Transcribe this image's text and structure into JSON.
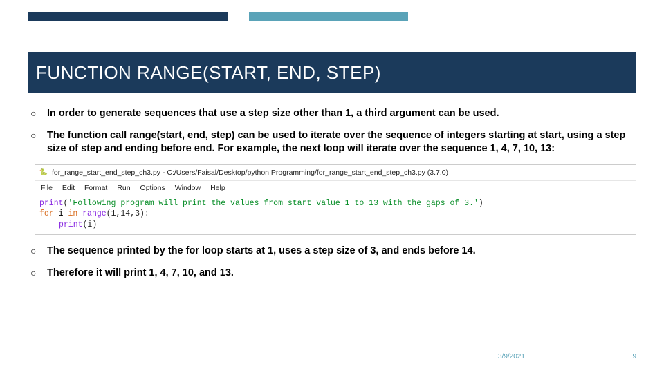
{
  "title": "FUNCTION RANGE(START, END, STEP)",
  "bullets": {
    "b1": "In order to generate sequences that use a step size other than 1, a third argument can be used.",
    "b2": "The function call range(start, end, step) can be used to iterate over the sequence of integers starting at start, using a step size of step and ending before end. For example, the next loop will iterate over the sequence 1, 4, 7, 10, 13:",
    "b3": "The sequence printed by the for loop starts at 1, uses a step size of 3, and ends before 14.",
    "b4": "Therefore it will print 1, 4, 7, 10, and 13."
  },
  "idle": {
    "icon": "🐍",
    "window_title": "for_range_start_end_step_ch3.py - C:/Users/Faisal/Desktop/python Programming/for_range_start_end_step_ch3.py (3.7.0)",
    "menus": {
      "file": "File",
      "edit": "Edit",
      "format": "Format",
      "run": "Run",
      "options": "Options",
      "window": "Window",
      "help": "Help"
    },
    "code": {
      "kw_print1": "print",
      "paren_open1": "(",
      "str1": "'Following program will print the values from start value 1 to 13 with the gaps of 3.'",
      "paren_close1": ")",
      "kw_for": "for",
      "var_i": " i ",
      "kw_in": "in",
      "fn_range": " range",
      "args": "(1,14,3):",
      "kw_print2": "print",
      "args2": "(i)"
    }
  },
  "footer": {
    "date": "3/9/2021",
    "page": "9"
  }
}
